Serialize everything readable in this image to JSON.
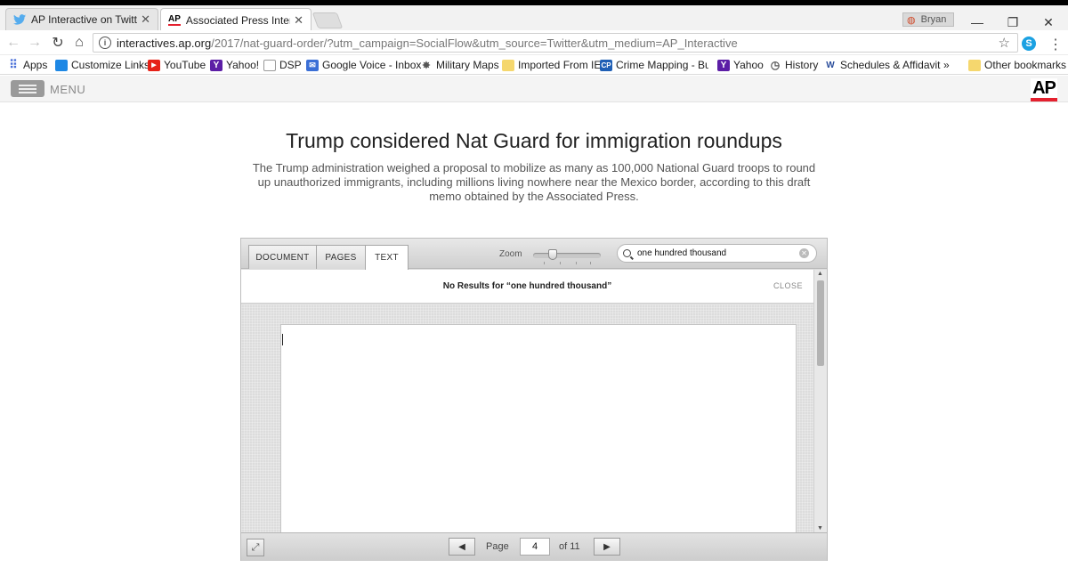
{
  "browser": {
    "tabs": [
      {
        "title": "AP Interactive on Twitter",
        "icon": "twitter-icon",
        "active": false
      },
      {
        "title": "Associated Press Interactive",
        "icon": "ap-favicon",
        "active": true
      }
    ],
    "profile_name": "Bryan",
    "url_host": "interactives.ap.org",
    "url_path": "/2017/nat-guard-order/?utm_campaign=SocialFlow&utm_source=Twitter&utm_medium=AP_Interactive",
    "bookmarks": [
      {
        "label": "Apps",
        "icon": "apps-grid-icon"
      },
      {
        "label": "Customize Links",
        "icon": "windows-icon"
      },
      {
        "label": "YouTube",
        "icon": "youtube-icon"
      },
      {
        "label": "Yahoo!",
        "icon": "yahoo-icon"
      },
      {
        "label": "DSP",
        "icon": "page-icon"
      },
      {
        "label": "Google Voice - Inbox",
        "icon": "google-voice-icon"
      },
      {
        "label": "Military Maps",
        "icon": "military-icon"
      },
      {
        "label": "Imported From IE",
        "icon": "folder-icon"
      },
      {
        "label": "Crime Mapping - Buil",
        "icon": "crime-mapping-icon"
      },
      {
        "label": "Yahoo",
        "icon": "yahoo-icon"
      },
      {
        "label": "History",
        "icon": "history-icon"
      },
      {
        "label": "Schedules & Affidavit",
        "icon": "w-icon"
      },
      {
        "label": "»",
        "icon": ""
      },
      {
        "label": "Other bookmarks",
        "icon": "folder-icon"
      }
    ]
  },
  "site": {
    "menu_label": "MENU",
    "logo_text": "AP",
    "headline": "Trump considered Nat Guard for immigration roundups",
    "dek": "The Trump administration weighed a proposal to mobilize as many as 100,000 National Guard troops to round up unauthorized immigrants, including millions living nowhere near the Mexico border, according to this draft memo obtained by the Associated Press."
  },
  "viewer": {
    "tabs": [
      "DOCUMENT",
      "PAGES",
      "TEXT"
    ],
    "active_tab": "TEXT",
    "zoom_label": "Zoom",
    "zoom_level": 0.25,
    "search_value": "one hundred thousand",
    "results_message": "No Results for “one hundred thousand”",
    "close_label": "CLOSE",
    "page_label": "Page",
    "current_page": "4",
    "page_total": "of 11"
  },
  "colors": {
    "ap_red": "#e4202e",
    "skype_blue": "#1ba1e2",
    "youtube_red": "#e62117",
    "yahoo_purple": "#5c1ea6"
  }
}
